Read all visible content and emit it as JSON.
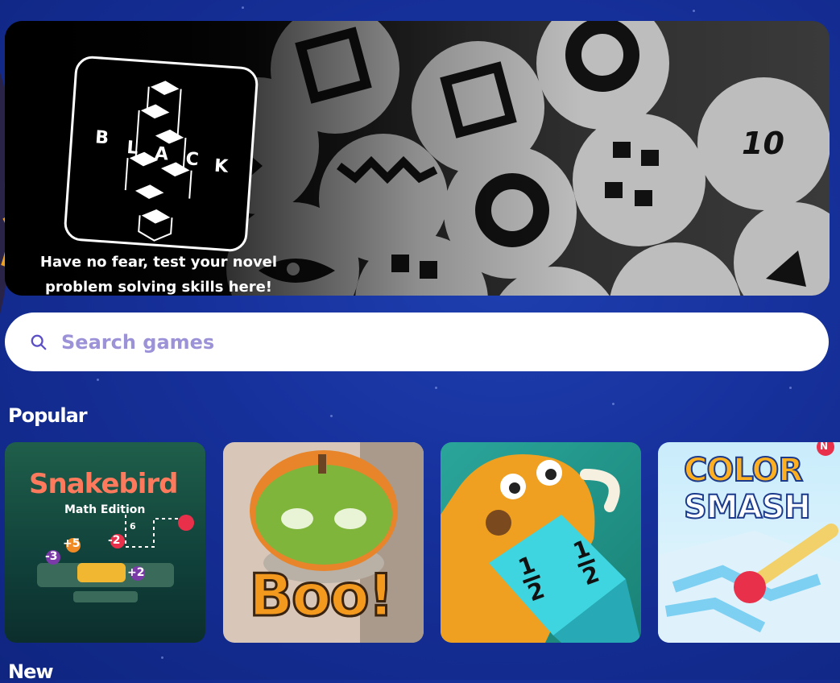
{
  "banner": {
    "logo_letters": [
      "B",
      "L",
      "A",
      "C",
      "K"
    ],
    "tagline_line1": "Have no fear, test your novel",
    "tagline_line2": "problem solving skills here!",
    "tile_number": "10"
  },
  "search": {
    "placeholder": "Search games",
    "icon": "search-icon"
  },
  "sections": {
    "popular_title": "Popular",
    "new_title": "New"
  },
  "popular_games": [
    {
      "title_line1": "Snakebird",
      "title_line2": "Math Edition",
      "numbers": [
        "6",
        "+5",
        "-2",
        "-3",
        "+2"
      ]
    },
    {
      "title": "Boo!"
    },
    {
      "fraction_top": "1",
      "fraction_bottom": "2"
    },
    {
      "title_line1": "COLOR",
      "title_line2": "SMASH",
      "badge": "N"
    }
  ],
  "colors": {
    "background": "#16309a",
    "search_placeholder": "#9b92d8",
    "snakebird_title": "#ff7a5c",
    "boo_orange": "#f39a1e",
    "mammoth_orange": "#f0a020",
    "color_smash_badge": "#e8304a"
  }
}
